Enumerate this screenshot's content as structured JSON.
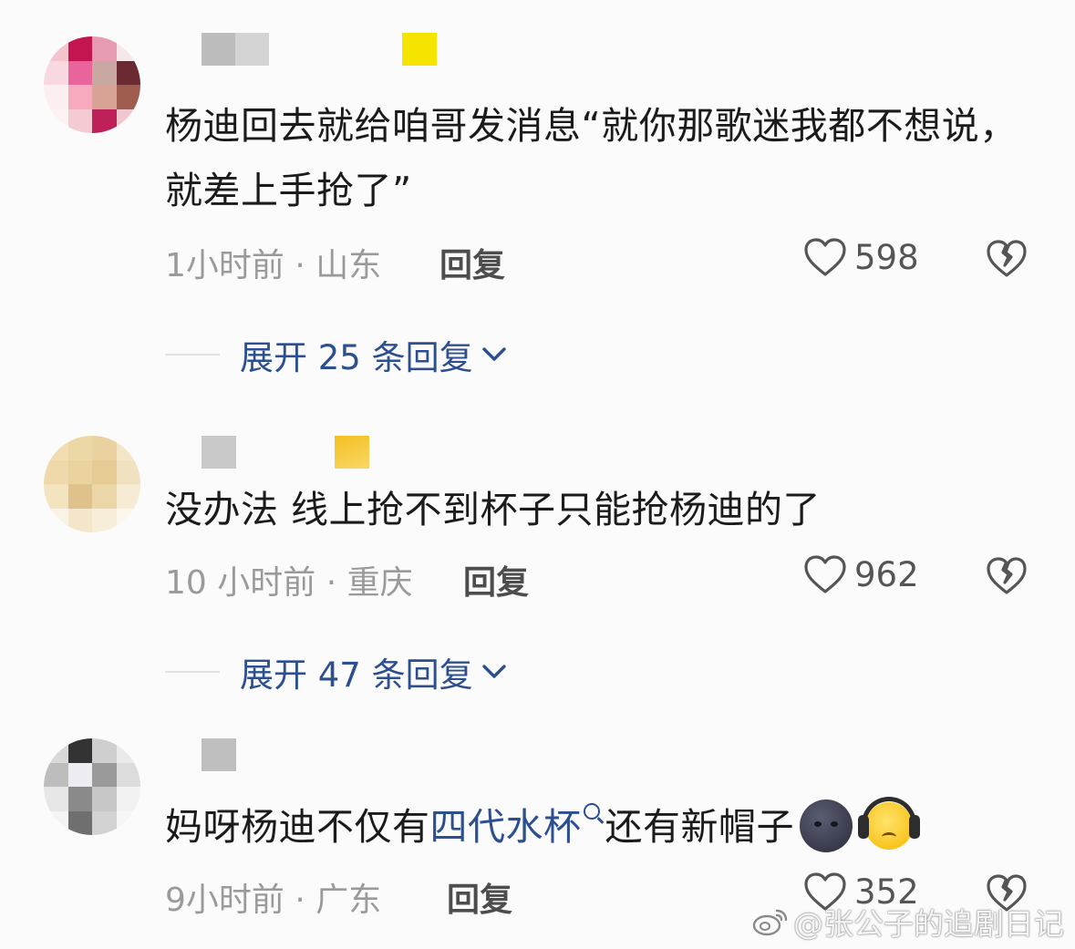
{
  "comments": [
    {
      "text_before": "杨迪回去就给咱哥发消息“就你那歌迷我都不想说，就差上手抢了”",
      "meta": "1小时前 · 山东",
      "reply_label": "回复",
      "likes": "598",
      "expand_label": "展开 25 条回复"
    },
    {
      "text_before": "没办法 线上抢不到杯子只能抢杨迪的了",
      "meta": "10 小时前 · 重庆",
      "reply_label": "回复",
      "likes": "962",
      "expand_label": "展开 47 条回复"
    },
    {
      "text_before": "妈呀杨迪不仅有",
      "text_link": "四代水杯",
      "text_after": "还有新帽子",
      "meta": "9小时前 · 广东",
      "reply_label": "回复",
      "likes": "352"
    }
  ],
  "watermark": "@张公子的追剧日记",
  "icons": {
    "like": "heart-outline-icon",
    "dislike": "broken-heart-icon",
    "expand": "chevron-down-icon",
    "search": "search-icon",
    "weibo": "weibo-logo-icon"
  },
  "colors": {
    "link": "#2c4f8f",
    "meta": "#9a9a9a",
    "text": "#1b1b1b"
  }
}
